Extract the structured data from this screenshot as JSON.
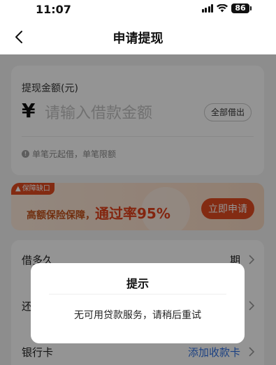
{
  "status_bar": {
    "time": "11:07",
    "battery": "86"
  },
  "nav": {
    "title": "申请提现"
  },
  "amount": {
    "label": "提现金额(元)",
    "currency": "¥",
    "placeholder": "请输入借款金额",
    "borrow_all": "全部借出",
    "hint": "单笔元起借，单笔限额"
  },
  "promo": {
    "tag": "保障缺口",
    "text": "高额保险保障，",
    "highlight": "通过率95%",
    "button": "立即申请"
  },
  "rows": [
    {
      "label": "借多久",
      "value": "期"
    },
    {
      "label": "还",
      "value": ""
    },
    {
      "label": "银行卡",
      "value": "添加收款卡"
    }
  ],
  "dialog": {
    "title": "提示",
    "message": "无可用贷款服务，请稍后重试"
  },
  "colors": {
    "accent": "#e24a1f",
    "link": "#2f6fe0"
  }
}
